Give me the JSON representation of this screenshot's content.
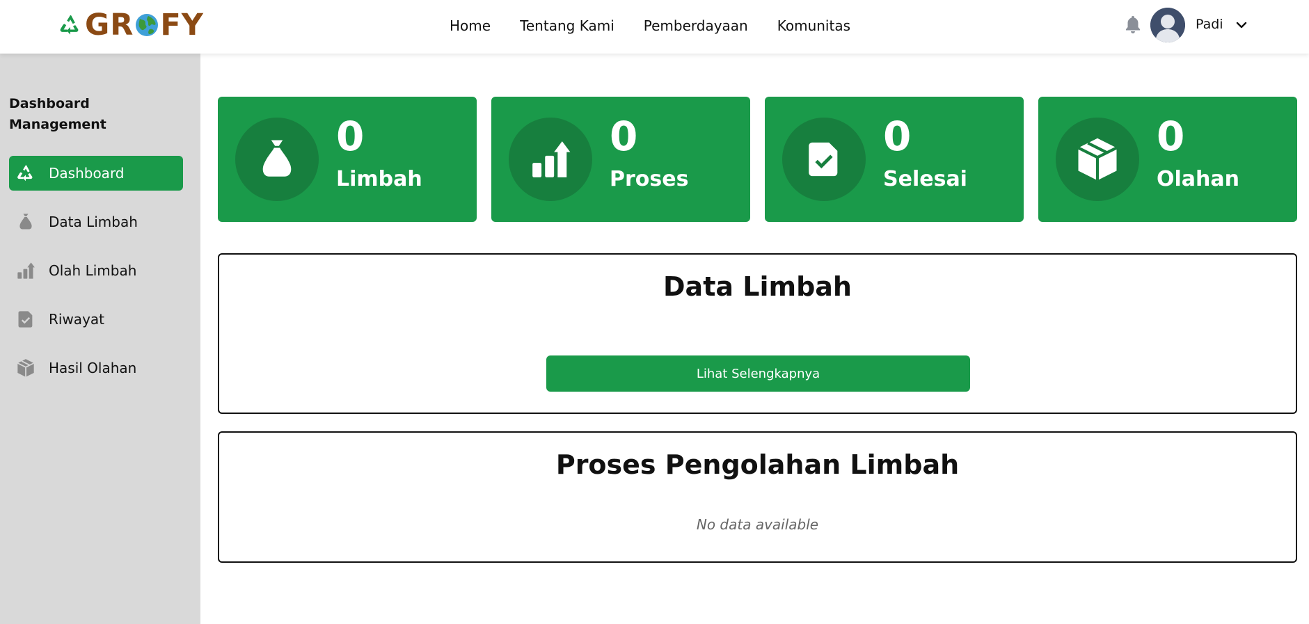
{
  "header": {
    "logo_text_before": "GR",
    "logo_text_after": "FY",
    "nav": [
      "Home",
      "Tentang Kami",
      "Pemberdayaan",
      "Komunitas"
    ],
    "user_name": "Padi"
  },
  "sidebar": {
    "title": "Dashboard Management",
    "items": [
      {
        "label": "Dashboard",
        "icon": "recycle-icon",
        "active": true
      },
      {
        "label": "Data Limbah",
        "icon": "waste-bag-icon",
        "active": false
      },
      {
        "label": "Olah Limbah",
        "icon": "chart-growth-icon",
        "active": false
      },
      {
        "label": "Riwayat",
        "icon": "file-check-icon",
        "active": false
      },
      {
        "label": "Hasil Olahan",
        "icon": "box-icon",
        "active": false
      }
    ]
  },
  "stats": [
    {
      "count": "0",
      "label": "Limbah",
      "icon": "waste-bag-icon"
    },
    {
      "count": "0",
      "label": "Proses",
      "icon": "chart-growth-icon"
    },
    {
      "count": "0",
      "label": "Selesai",
      "icon": "file-check-icon"
    },
    {
      "count": "0",
      "label": "Olahan",
      "icon": "box-icon"
    }
  ],
  "panels": {
    "data_limbah": {
      "title": "Data Limbah",
      "button": "Lihat Selengkapnya"
    },
    "proses": {
      "title": "Proses Pengolahan Limbah",
      "empty": "No data available"
    }
  },
  "colors": {
    "primary_green": "#1a9a4a",
    "dark_green": "#177f3e",
    "sidebar_bg": "#d9d9d9",
    "logo_brown": "#8b4a14"
  }
}
